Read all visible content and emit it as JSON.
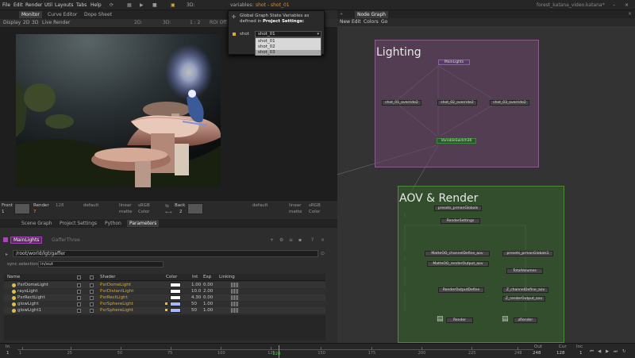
{
  "menubar": {
    "items": [
      "File",
      "Edit",
      "Render",
      "Util",
      "Layouts",
      "Tabs",
      "Help"
    ],
    "mode_3d": "3D:",
    "variables_label": "variables:",
    "variables_value": "shot",
    "variables_value2": "shot_01",
    "project_title": "forest_katana_video.katana*"
  },
  "viewer": {
    "tabs": [
      "Monitor",
      "Curve Editor",
      "Dope Sheet"
    ],
    "toolbar": [
      "Display",
      "2D",
      "3D",
      "Live Render"
    ],
    "toolbar_right": [
      "2D:",
      "3D:",
      "1 : 2",
      "ROI Off"
    ],
    "front_label": "Front",
    "front_value": "1",
    "render_label": "Render",
    "render_value": "7",
    "back_label": "Back",
    "back_value": "2",
    "res": "128",
    "lut_default": "default",
    "lut_linear": "linear",
    "lut_srgb": "sRGB",
    "lut_matte": "matte",
    "lut_color": "Color",
    "res2": "128"
  },
  "popup": {
    "title_line1": "Global Graph State Variables as",
    "title_line2": "defined in",
    "title_bold": "Project Settings:",
    "shot_label": "shot",
    "shot_value": "shot_01",
    "options": [
      "shot_01",
      "shot_02",
      "shot_03"
    ]
  },
  "lower": {
    "tabs": [
      "Scene Graph",
      "Project Settings",
      "Python",
      "Parameters"
    ],
    "node_name": "MainLights",
    "node_type": "GafferThree",
    "path": "/root/world/lgt/gaffer",
    "sync_label": "sync selection",
    "sync_value": "in/out",
    "columns": [
      "Name",
      "Shader",
      "Color",
      "Int",
      "Exp",
      "Linking"
    ],
    "rows": [
      {
        "name": "PxrDomeLight",
        "shader": "PxrDomeLight",
        "int": "1.00",
        "exp": "0.00",
        "color": "#ffffff"
      },
      {
        "name": "raysLight",
        "shader": "PxrDistantLight",
        "int": "10.0",
        "exp": "2.00",
        "color": "#ffffff"
      },
      {
        "name": "PxrRectLight",
        "shader": "PxrRectLight",
        "int": "4.30",
        "exp": "0.00",
        "color": "#ffffff"
      },
      {
        "name": "glowLight",
        "shader": "PxrSphereLight",
        "int": "50",
        "exp": "1.00",
        "color": "#a8b8ff"
      },
      {
        "name": "glowLight1",
        "shader": "PxrSphereLight",
        "int": "50",
        "exp": "1.00",
        "color": "#a8b8ff"
      }
    ]
  },
  "nodegraph": {
    "tab": "Node Graph",
    "menu": [
      "New",
      "Edit",
      "Colors",
      "Go"
    ],
    "backdrop_lighting": "Lighting",
    "backdrop_aov": "AOV & Render",
    "nodes": {
      "mainlights": "MainLights",
      "o1": "shot_01_override2",
      "o2": "shot_02_override2",
      "o3": "shot_03_override2",
      "switch": "VariableSwitch36",
      "globals": "presets_prmanGlobals",
      "rendersettings": "RenderSettings",
      "matteobj": "MatteOO_channelDefine_aov",
      "pglobals1": "presets_prmanGlobals1",
      "matteout": "MatteOO_renderOutput_aov",
      "totalvol": "TotalVolumes",
      "rod": "RenderOutputDefine",
      "zchan": "Z_channelDefine_aov",
      "zout": "Z_renderOutput_aov",
      "render": "Render",
      "prender": "zRender"
    }
  },
  "timeline": {
    "in_label": "In",
    "in_value": "1",
    "ticks": [
      "1",
      "25",
      "50",
      "75",
      "100",
      "125",
      "150",
      "175",
      "200",
      "225",
      "248"
    ],
    "current": "128",
    "out_label": "Out",
    "out_value": "248",
    "cur_label": "Cur",
    "cur_value": "128",
    "inc_label": "Inc",
    "inc_value": "1"
  }
}
